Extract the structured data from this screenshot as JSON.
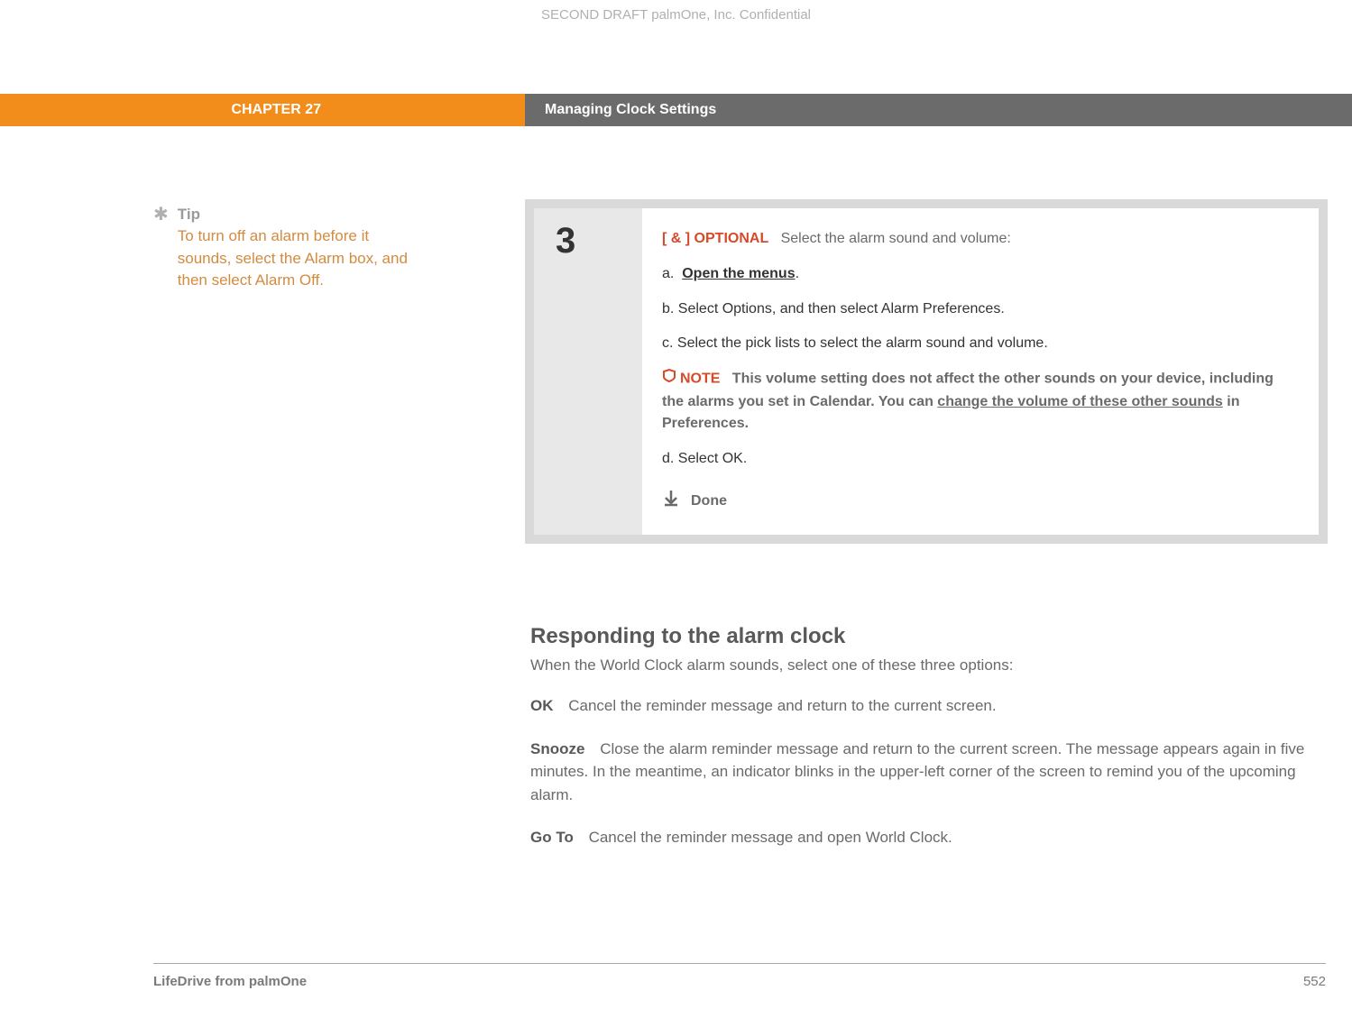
{
  "header": {
    "draft_notice": "SECOND DRAFT palmOne, Inc.  Confidential",
    "chapter_label": "CHAPTER 27",
    "chapter_title": "Managing Clock Settings"
  },
  "sidebar": {
    "tip_label": "Tip",
    "tip_body": "To turn off an alarm before it sounds, select the Alarm box, and then select Alarm Off."
  },
  "step": {
    "number": "3",
    "optional_tag": "[ & ]  OPTIONAL",
    "optional_text": "Select the alarm sound and volume:",
    "items": {
      "a_prefix": "a.",
      "a_link": "Open the menus",
      "a_suffix": ".",
      "b": "b.  Select Options, and then select Alarm Preferences.",
      "c": "c.  Select the pick lists to select the alarm sound and volume.",
      "d": "d.  Select OK."
    },
    "note": {
      "label": "NOTE",
      "text_before": "This volume setting does not affect the other sounds on your device, including the alarms you set in Calendar. You can ",
      "link": "change the volume of these other sounds",
      "text_after": " in Preferences."
    },
    "done_label": "Done"
  },
  "section": {
    "heading": "Responding to the alarm clock",
    "intro": "When the World Clock alarm sounds, select one of these three options:",
    "options": [
      {
        "label": "OK",
        "text": "Cancel the reminder message and return to the current screen."
      },
      {
        "label": "Snooze",
        "text": "Close the alarm reminder message and return to the current screen. The message appears again in five minutes. In the meantime, an indicator blinks in the upper-left corner of the screen to remind you of the upcoming alarm."
      },
      {
        "label": "Go To",
        "text": "Cancel the reminder message and open World Clock."
      }
    ]
  },
  "footer": {
    "product": "LifeDrive from palmOne",
    "page": "552"
  }
}
